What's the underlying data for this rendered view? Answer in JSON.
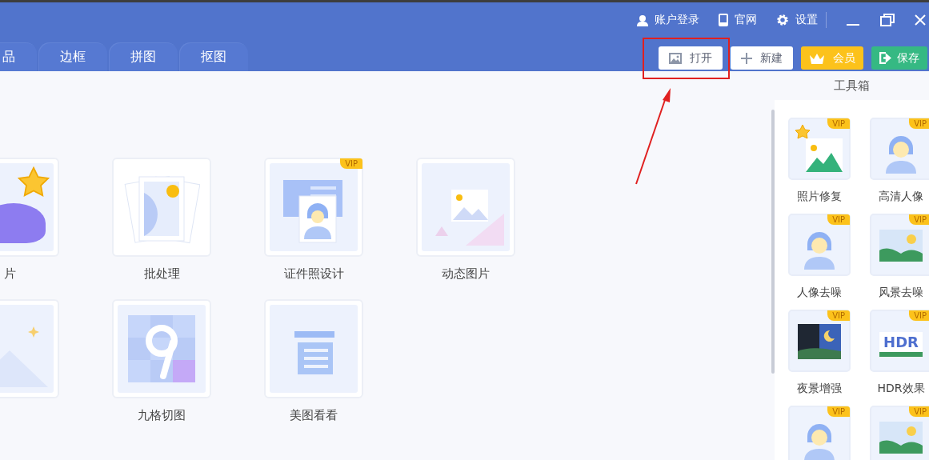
{
  "top_links": [
    {
      "label": "账户登录",
      "kind": "user"
    },
    {
      "label": "官网",
      "kind": "phone"
    },
    {
      "label": "设置",
      "kind": "gear"
    }
  ],
  "tabs": [
    {
      "label": "品"
    },
    {
      "label": "边框"
    },
    {
      "label": "拼图"
    },
    {
      "label": "抠图"
    }
  ],
  "actions": [
    {
      "label": "打开",
      "kind": "open"
    },
    {
      "label": "新建",
      "kind": "new"
    },
    {
      "label": "会员",
      "kind": "vip"
    },
    {
      "label": "保存",
      "kind": "save"
    }
  ],
  "features": [
    {
      "label": "片",
      "kind": "star"
    },
    {
      "label": "批处理",
      "kind": "batch"
    },
    {
      "label": "证件照设计",
      "kind": "id",
      "badge": "VIP"
    },
    {
      "label": "动态图片",
      "kind": "picture"
    },
    {
      "kind": "plain"
    },
    {
      "label": "九格切图",
      "kind": "nine"
    },
    {
      "label": "美图看看",
      "kind": "viewer"
    }
  ],
  "toolbox": {
    "title": "工具箱",
    "tools": [
      {
        "label": "照片修复",
        "kind": "restore",
        "badge": "VIP"
      },
      {
        "label": "高清人像",
        "kind": "portrait",
        "badge": "VIP"
      },
      {
        "label": "人像去噪",
        "kind": "portrait",
        "badge": "VIP"
      },
      {
        "label": "风景去噪",
        "kind": "landscape",
        "badge": "VIP"
      },
      {
        "label": "夜景增强",
        "kind": "night",
        "badge": "VIP"
      },
      {
        "label": "HDR效果",
        "kind": "hdr",
        "badge": "VIP",
        "art_text": "HDR"
      },
      {
        "kind": "portrait",
        "badge": "VIP"
      },
      {
        "kind": "landscape",
        "badge": "VIP"
      }
    ]
  },
  "annotation": {
    "kind": "highlight-arrow"
  }
}
